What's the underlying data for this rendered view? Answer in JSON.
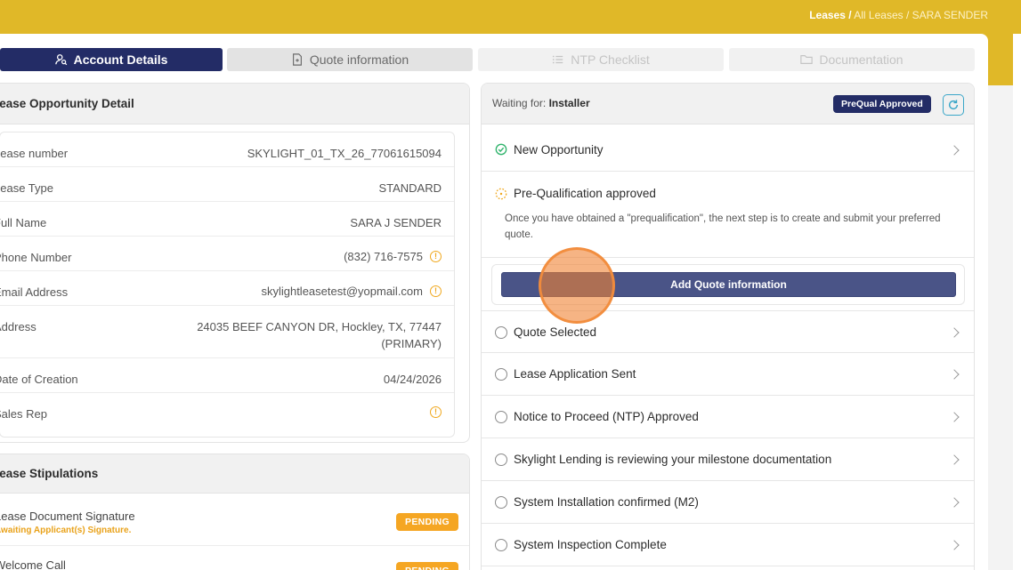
{
  "breadcrumb": {
    "root": "Leases /",
    "parent": "All Leases /",
    "current": "SARA SENDER"
  },
  "tabs": [
    {
      "label": "Account Details",
      "icon": "user-search-icon"
    },
    {
      "label": "Quote information",
      "icon": "document-icon"
    },
    {
      "label": "NTP Checklist",
      "icon": "list-icon"
    },
    {
      "label": "Documentation",
      "icon": "folder-icon"
    }
  ],
  "detail": {
    "title": "Lease Opportunity Detail",
    "rows": [
      {
        "label": "Lease number",
        "value": "SKYLIGHT_01_TX_26_77061615094"
      },
      {
        "label": "Lease Type",
        "value": "STANDARD"
      },
      {
        "label": "Full Name",
        "value": "SARA J SENDER"
      },
      {
        "label": "Phone Number",
        "value": "(832) 716-7575"
      },
      {
        "label": "Email Address",
        "value": "skylightleasetest@yopmail.com"
      },
      {
        "label": "Address",
        "value_line1": "24035 BEEF CANYON DR, Hockley, TX, 77447",
        "value_line2": "(PRIMARY)"
      },
      {
        "label": "Date of Creation",
        "value": "04/24/2026"
      },
      {
        "label": "Sales Rep",
        "value": ""
      }
    ]
  },
  "stipulations": {
    "title": "Lease Stipulations",
    "items": [
      {
        "title": "Lease Document Signature",
        "sub": "Awaiting Applicant(s) Signature.",
        "status": "PENDING"
      },
      {
        "title": "Welcome Call",
        "sub": "",
        "status": "PENDING"
      }
    ]
  },
  "status": {
    "waiting_label": "Waiting for:",
    "waiting_value": "Installer",
    "badge": "PreQual Approved",
    "steps": [
      {
        "label": "New Opportunity",
        "state": "done"
      },
      {
        "label": "Pre-Qualification approved",
        "state": "current"
      },
      {
        "label": "Quote Selected",
        "state": "todo"
      },
      {
        "label": "Lease Application Sent",
        "state": "todo"
      },
      {
        "label": "Notice to Proceed (NTP) Approved",
        "state": "todo"
      },
      {
        "label": "Skylight Lending is reviewing your milestone documentation",
        "state": "todo"
      },
      {
        "label": "System Installation confirmed (M2)",
        "state": "todo"
      },
      {
        "label": "System Inspection Complete",
        "state": "todo"
      }
    ],
    "description": "Once you have obtained a \"prequalification\", the next step is to create and submit your preferred quote.",
    "add_button": "Add Quote information"
  },
  "colors": {
    "brand_yellow": "#e0b828",
    "navy": "#232c66",
    "pending": "#f5a623",
    "done_green": "#2fb36b"
  }
}
